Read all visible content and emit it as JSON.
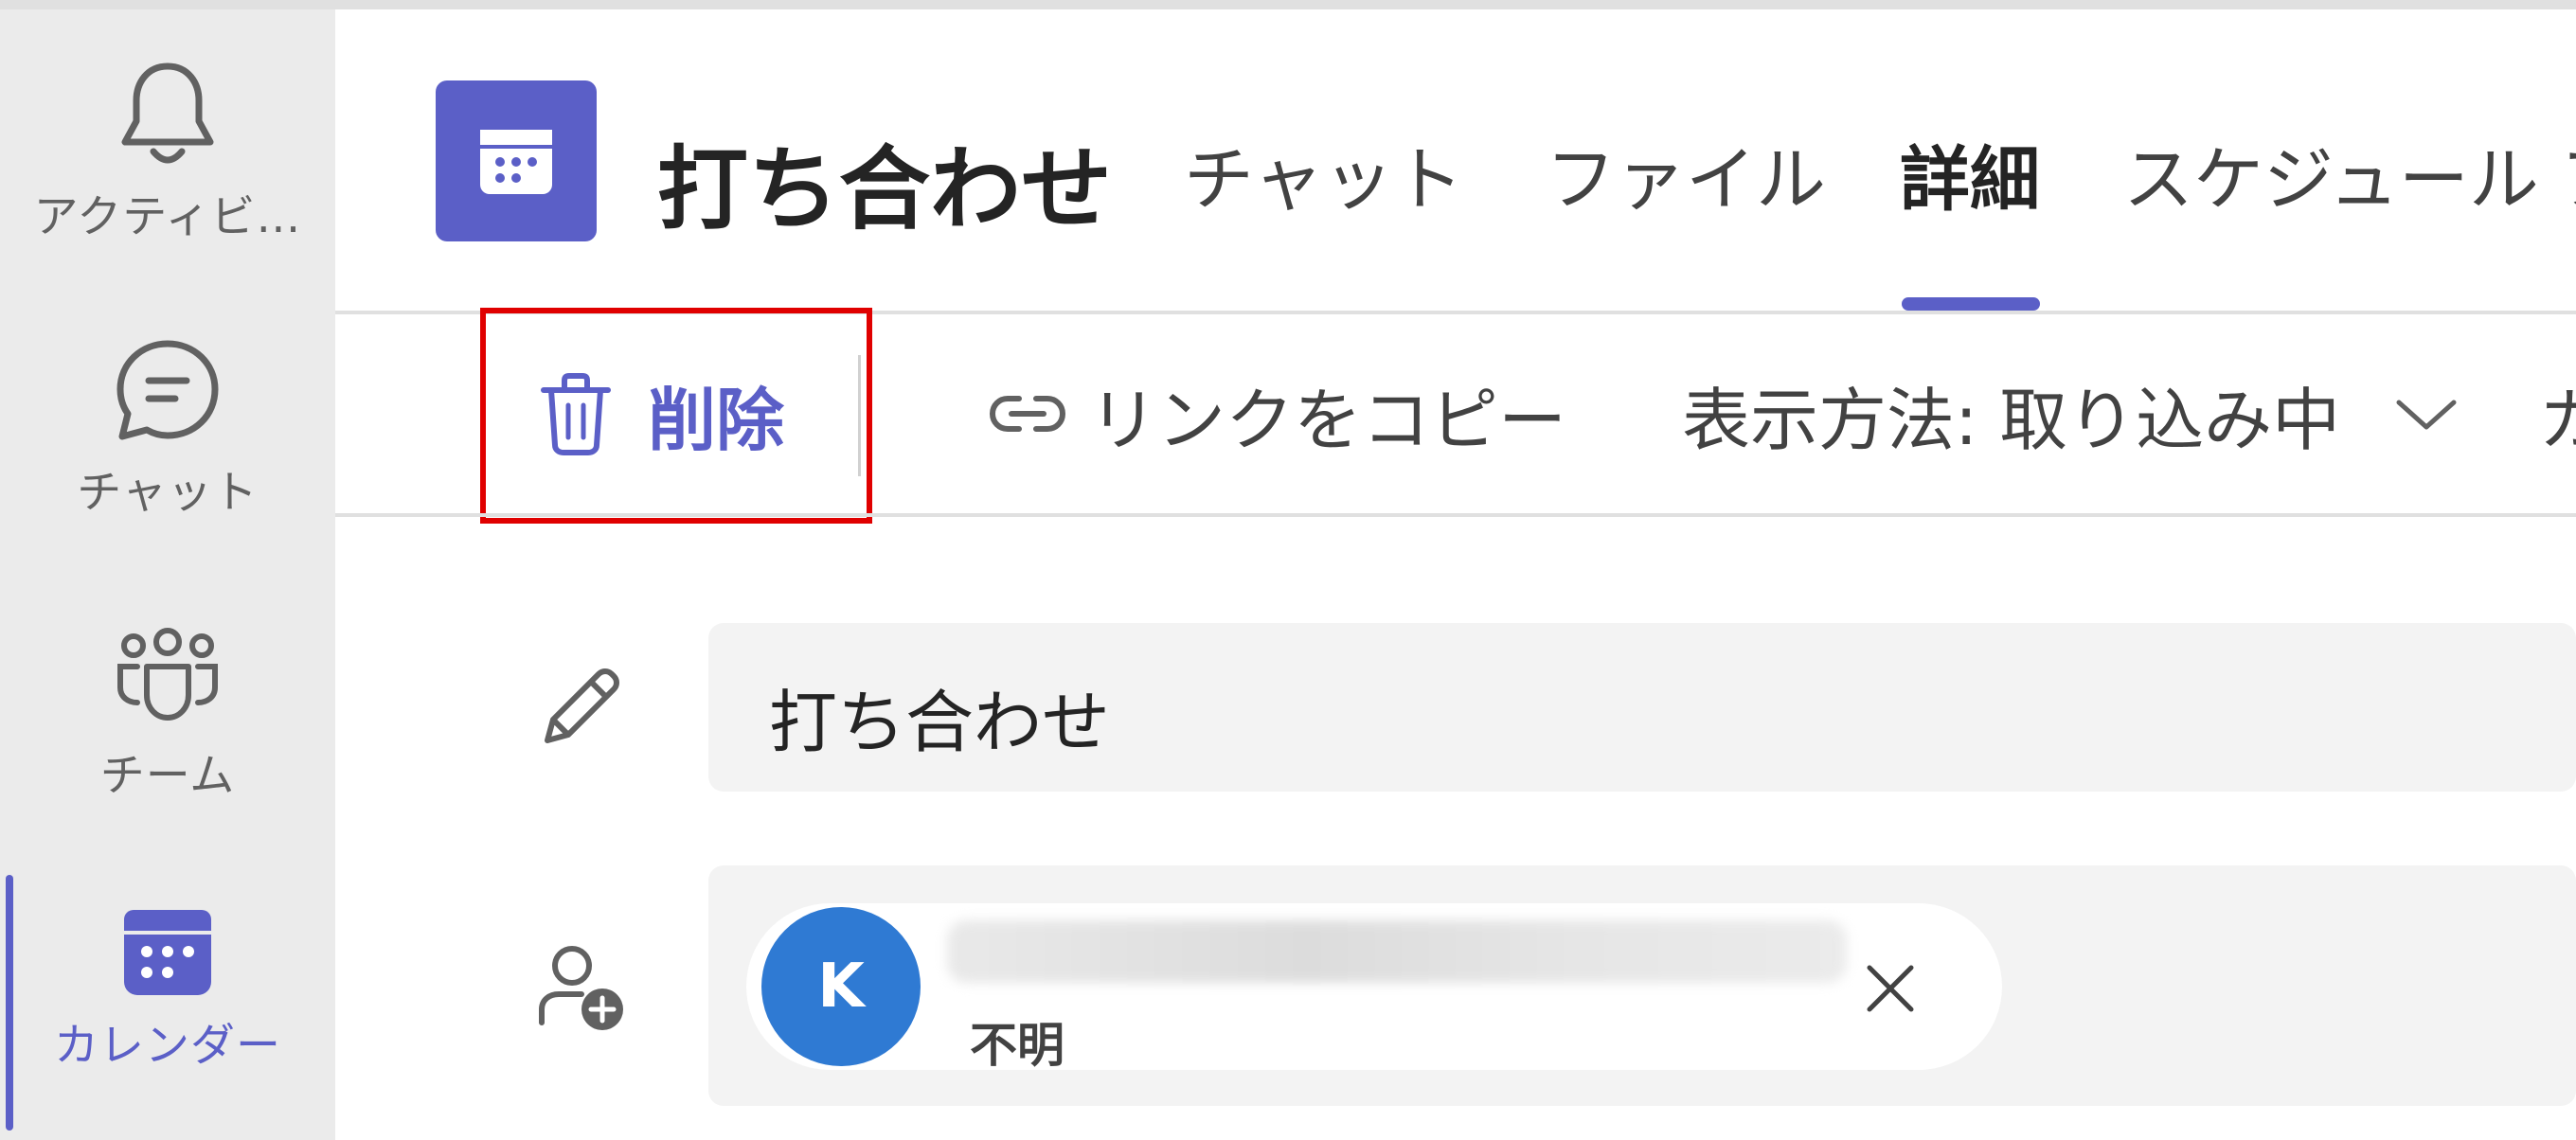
{
  "rail": {
    "items": [
      {
        "label": "アクティビ…",
        "icon": "bell-icon"
      },
      {
        "label": "チャット",
        "icon": "chat-icon"
      },
      {
        "label": "チーム",
        "icon": "teams-icon"
      },
      {
        "label": "カレンダー",
        "icon": "calendar-icon",
        "active": true
      }
    ]
  },
  "header": {
    "title": "打ち合わせ",
    "tabs": [
      {
        "label": "チャット"
      },
      {
        "label": "ファイル"
      },
      {
        "label": "詳細",
        "active": true
      },
      {
        "label": "スケジュール ア"
      }
    ]
  },
  "toolbar": {
    "delete_label": "削除",
    "copy_link_label": "リンクをコピー",
    "show_as_label": "表示方法: 取り込み中",
    "overflow_label": "カ"
  },
  "form": {
    "title_value": "打ち合わせ",
    "attendee": {
      "initial": "K",
      "status": "不明"
    }
  },
  "colors": {
    "accent": "#5b5fc7",
    "avatar": "#2f7ad3",
    "highlight": "#e00000"
  }
}
